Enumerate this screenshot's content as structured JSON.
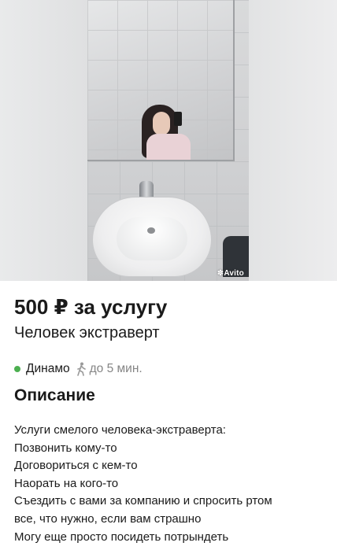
{
  "listing": {
    "photo_watermark": "Avito",
    "price": "500 ₽ за услугу",
    "title": "Человек экстраверт",
    "location": {
      "metro": "Динамо",
      "metro_color": "#4caf50",
      "walk_icon": "walking-person-icon",
      "walk_time": "до 5 мин."
    },
    "description": {
      "heading": "Описание",
      "lines": [
        "Услуги смелого человека-экстраверта:",
        "Позвонить кому-то",
        "Договориться с кем-то",
        "Наорать на кого-то",
        "Съездить с вами за компанию и спросить ртом",
        "все, что нужно, если вам страшно",
        "Могу еще просто посидеть потрындеть"
      ]
    }
  }
}
